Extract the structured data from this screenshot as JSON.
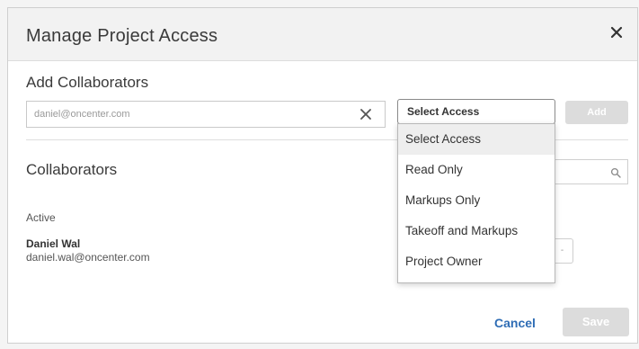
{
  "dialog": {
    "title": "Manage Project Access"
  },
  "add_section": {
    "title": "Add Collaborators",
    "email_value": "daniel@oncenter.com",
    "select_value": "Select Access",
    "add_label": "Add",
    "options": [
      {
        "label": "Select Access",
        "selected": true
      },
      {
        "label": "Read Only",
        "selected": false
      },
      {
        "label": "Markups Only",
        "selected": false
      },
      {
        "label": "Takeoff and Markups",
        "selected": false
      },
      {
        "label": "Project Owner",
        "selected": false
      }
    ]
  },
  "collaborators": {
    "title": "Collaborators",
    "status_label": "Active",
    "users": [
      {
        "name": "Daniel Wal",
        "email": "daniel.wal@oncenter.com"
      }
    ]
  },
  "footer": {
    "cancel_label": "Cancel",
    "save_label": "Save"
  },
  "colors": {
    "accent": "#2f6db5",
    "disabled_button": "#dcdcdc",
    "header_bg": "#f2f2f2"
  },
  "icons": {
    "close": "close-icon",
    "clear": "clear-icon",
    "search": "search-icon"
  }
}
